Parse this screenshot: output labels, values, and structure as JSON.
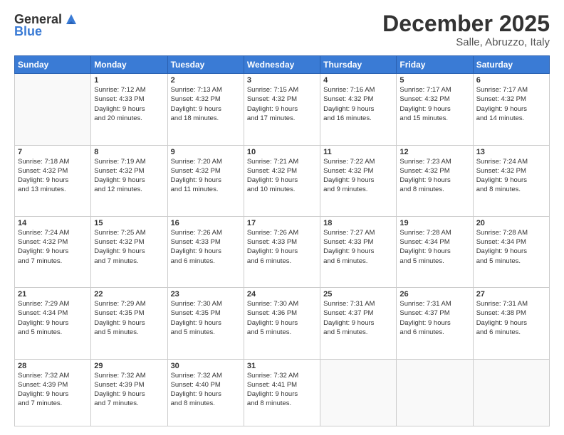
{
  "header": {
    "logo_general": "General",
    "logo_blue": "Blue",
    "month_title": "December 2025",
    "location": "Salle, Abruzzo, Italy"
  },
  "weekdays": [
    "Sunday",
    "Monday",
    "Tuesday",
    "Wednesday",
    "Thursday",
    "Friday",
    "Saturday"
  ],
  "weeks": [
    [
      {
        "day": "",
        "info": ""
      },
      {
        "day": "1",
        "info": "Sunrise: 7:12 AM\nSunset: 4:33 PM\nDaylight: 9 hours\nand 20 minutes."
      },
      {
        "day": "2",
        "info": "Sunrise: 7:13 AM\nSunset: 4:32 PM\nDaylight: 9 hours\nand 18 minutes."
      },
      {
        "day": "3",
        "info": "Sunrise: 7:15 AM\nSunset: 4:32 PM\nDaylight: 9 hours\nand 17 minutes."
      },
      {
        "day": "4",
        "info": "Sunrise: 7:16 AM\nSunset: 4:32 PM\nDaylight: 9 hours\nand 16 minutes."
      },
      {
        "day": "5",
        "info": "Sunrise: 7:17 AM\nSunset: 4:32 PM\nDaylight: 9 hours\nand 15 minutes."
      },
      {
        "day": "6",
        "info": "Sunrise: 7:17 AM\nSunset: 4:32 PM\nDaylight: 9 hours\nand 14 minutes."
      }
    ],
    [
      {
        "day": "7",
        "info": "Sunrise: 7:18 AM\nSunset: 4:32 PM\nDaylight: 9 hours\nand 13 minutes."
      },
      {
        "day": "8",
        "info": "Sunrise: 7:19 AM\nSunset: 4:32 PM\nDaylight: 9 hours\nand 12 minutes."
      },
      {
        "day": "9",
        "info": "Sunrise: 7:20 AM\nSunset: 4:32 PM\nDaylight: 9 hours\nand 11 minutes."
      },
      {
        "day": "10",
        "info": "Sunrise: 7:21 AM\nSunset: 4:32 PM\nDaylight: 9 hours\nand 10 minutes."
      },
      {
        "day": "11",
        "info": "Sunrise: 7:22 AM\nSunset: 4:32 PM\nDaylight: 9 hours\nand 9 minutes."
      },
      {
        "day": "12",
        "info": "Sunrise: 7:23 AM\nSunset: 4:32 PM\nDaylight: 9 hours\nand 8 minutes."
      },
      {
        "day": "13",
        "info": "Sunrise: 7:24 AM\nSunset: 4:32 PM\nDaylight: 9 hours\nand 8 minutes."
      }
    ],
    [
      {
        "day": "14",
        "info": "Sunrise: 7:24 AM\nSunset: 4:32 PM\nDaylight: 9 hours\nand 7 minutes."
      },
      {
        "day": "15",
        "info": "Sunrise: 7:25 AM\nSunset: 4:32 PM\nDaylight: 9 hours\nand 7 minutes."
      },
      {
        "day": "16",
        "info": "Sunrise: 7:26 AM\nSunset: 4:33 PM\nDaylight: 9 hours\nand 6 minutes."
      },
      {
        "day": "17",
        "info": "Sunrise: 7:26 AM\nSunset: 4:33 PM\nDaylight: 9 hours\nand 6 minutes."
      },
      {
        "day": "18",
        "info": "Sunrise: 7:27 AM\nSunset: 4:33 PM\nDaylight: 9 hours\nand 6 minutes."
      },
      {
        "day": "19",
        "info": "Sunrise: 7:28 AM\nSunset: 4:34 PM\nDaylight: 9 hours\nand 5 minutes."
      },
      {
        "day": "20",
        "info": "Sunrise: 7:28 AM\nSunset: 4:34 PM\nDaylight: 9 hours\nand 5 minutes."
      }
    ],
    [
      {
        "day": "21",
        "info": "Sunrise: 7:29 AM\nSunset: 4:34 PM\nDaylight: 9 hours\nand 5 minutes."
      },
      {
        "day": "22",
        "info": "Sunrise: 7:29 AM\nSunset: 4:35 PM\nDaylight: 9 hours\nand 5 minutes."
      },
      {
        "day": "23",
        "info": "Sunrise: 7:30 AM\nSunset: 4:35 PM\nDaylight: 9 hours\nand 5 minutes."
      },
      {
        "day": "24",
        "info": "Sunrise: 7:30 AM\nSunset: 4:36 PM\nDaylight: 9 hours\nand 5 minutes."
      },
      {
        "day": "25",
        "info": "Sunrise: 7:31 AM\nSunset: 4:37 PM\nDaylight: 9 hours\nand 5 minutes."
      },
      {
        "day": "26",
        "info": "Sunrise: 7:31 AM\nSunset: 4:37 PM\nDaylight: 9 hours\nand 6 minutes."
      },
      {
        "day": "27",
        "info": "Sunrise: 7:31 AM\nSunset: 4:38 PM\nDaylight: 9 hours\nand 6 minutes."
      }
    ],
    [
      {
        "day": "28",
        "info": "Sunrise: 7:32 AM\nSunset: 4:39 PM\nDaylight: 9 hours\nand 7 minutes."
      },
      {
        "day": "29",
        "info": "Sunrise: 7:32 AM\nSunset: 4:39 PM\nDaylight: 9 hours\nand 7 minutes."
      },
      {
        "day": "30",
        "info": "Sunrise: 7:32 AM\nSunset: 4:40 PM\nDaylight: 9 hours\nand 8 minutes."
      },
      {
        "day": "31",
        "info": "Sunrise: 7:32 AM\nSunset: 4:41 PM\nDaylight: 9 hours\nand 8 minutes."
      },
      {
        "day": "",
        "info": ""
      },
      {
        "day": "",
        "info": ""
      },
      {
        "day": "",
        "info": ""
      }
    ]
  ]
}
